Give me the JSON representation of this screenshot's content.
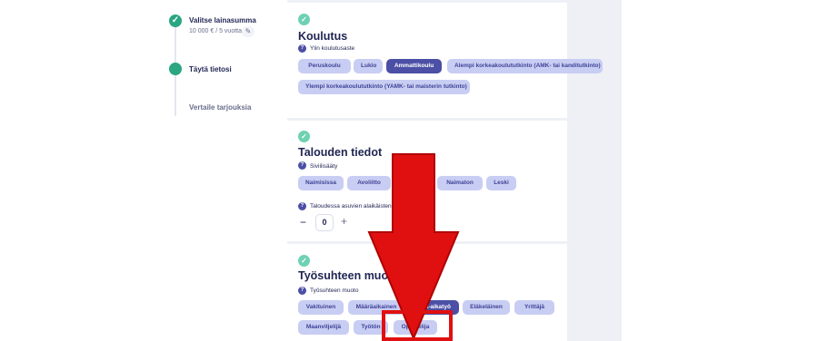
{
  "sidebar": {
    "steps": [
      {
        "title": "Valitse lainasumma",
        "subtitle": "10 000 € / 5 vuotta",
        "status": "done",
        "edit_icon": "pencil-icon"
      },
      {
        "title": "Täytä tietosi",
        "status": "active"
      },
      {
        "title": "Vertaile tarjouksia",
        "status": "pending"
      }
    ]
  },
  "sections": {
    "koulutus": {
      "title": "Koulutus",
      "question": "Ylin koulutusaste",
      "options": [
        "Peruskoulu",
        "Lukio",
        "Ammattikoulu",
        "Alempi korkeakoulututkinto (AMK- tai kanditutkinto)",
        "Ylempi korkeakoulututkinto (YAMK- tai maisterin tutkinto)"
      ],
      "selected": "Ammattikoulu"
    },
    "talous": {
      "title": "Talouden tiedot",
      "question": "Siviilisääty",
      "options": [
        "Naimisissa",
        "Avoliitto",
        "",
        "Naimaton",
        "Leski"
      ],
      "children_question": "Taloudessa asuvien alaikäisten la",
      "children_value": "0",
      "minus_symbol": "−",
      "plus_symbol": "+"
    },
    "tyosuhde": {
      "title": "Työsuhteen muoto",
      "question": "Työsuhteen muoto",
      "options": [
        "Vakituinen",
        "Määräaikainen",
        "Osa-aikatyö",
        "Eläkeläinen",
        "Yrittäjä",
        "Maanviljelijä",
        "Työtön",
        "Opiskelija"
      ],
      "selected": "Osa-aikatyö"
    }
  },
  "symbols": {
    "check": "✓",
    "question": "?",
    "pencil": "✎"
  },
  "colors": {
    "accent": "#4b4fa5",
    "chip": "#c8cdf3",
    "success": "#2aa681",
    "annotation": "#e01010"
  }
}
